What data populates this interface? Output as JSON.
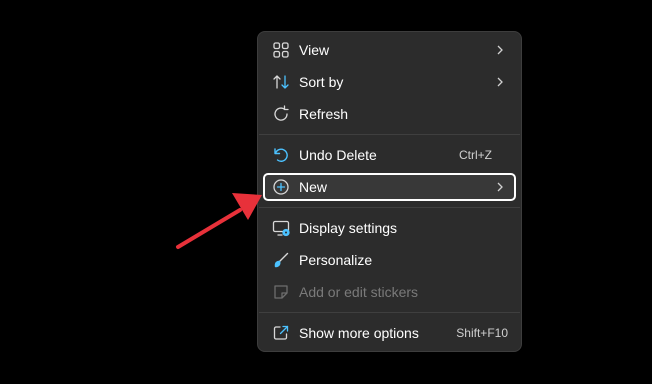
{
  "menu": {
    "items": [
      {
        "label": "View",
        "icon": "view-grid-icon",
        "submenu": true
      },
      {
        "label": "Sort by",
        "icon": "sort-icon",
        "submenu": true
      },
      {
        "label": "Refresh",
        "icon": "refresh-icon"
      },
      {
        "label": "Undo Delete",
        "icon": "undo-icon",
        "shortcut": "Ctrl+Z"
      },
      {
        "label": "New",
        "icon": "plus-circle-icon",
        "submenu": true,
        "highlighted": true
      },
      {
        "label": "Display settings",
        "icon": "display-settings-icon"
      },
      {
        "label": "Personalize",
        "icon": "brush-icon"
      },
      {
        "label": "Add or edit stickers",
        "icon": "sticker-icon",
        "disabled": true
      },
      {
        "label": "Show more options",
        "icon": "show-more-icon",
        "shortcut": "Shift+F10"
      }
    ]
  },
  "colors": {
    "desktop_bg": "#000000",
    "menu_bg": "#2c2c2c",
    "accent_icon": "#4cc2ff",
    "annotation_arrow": "#e8313a"
  }
}
